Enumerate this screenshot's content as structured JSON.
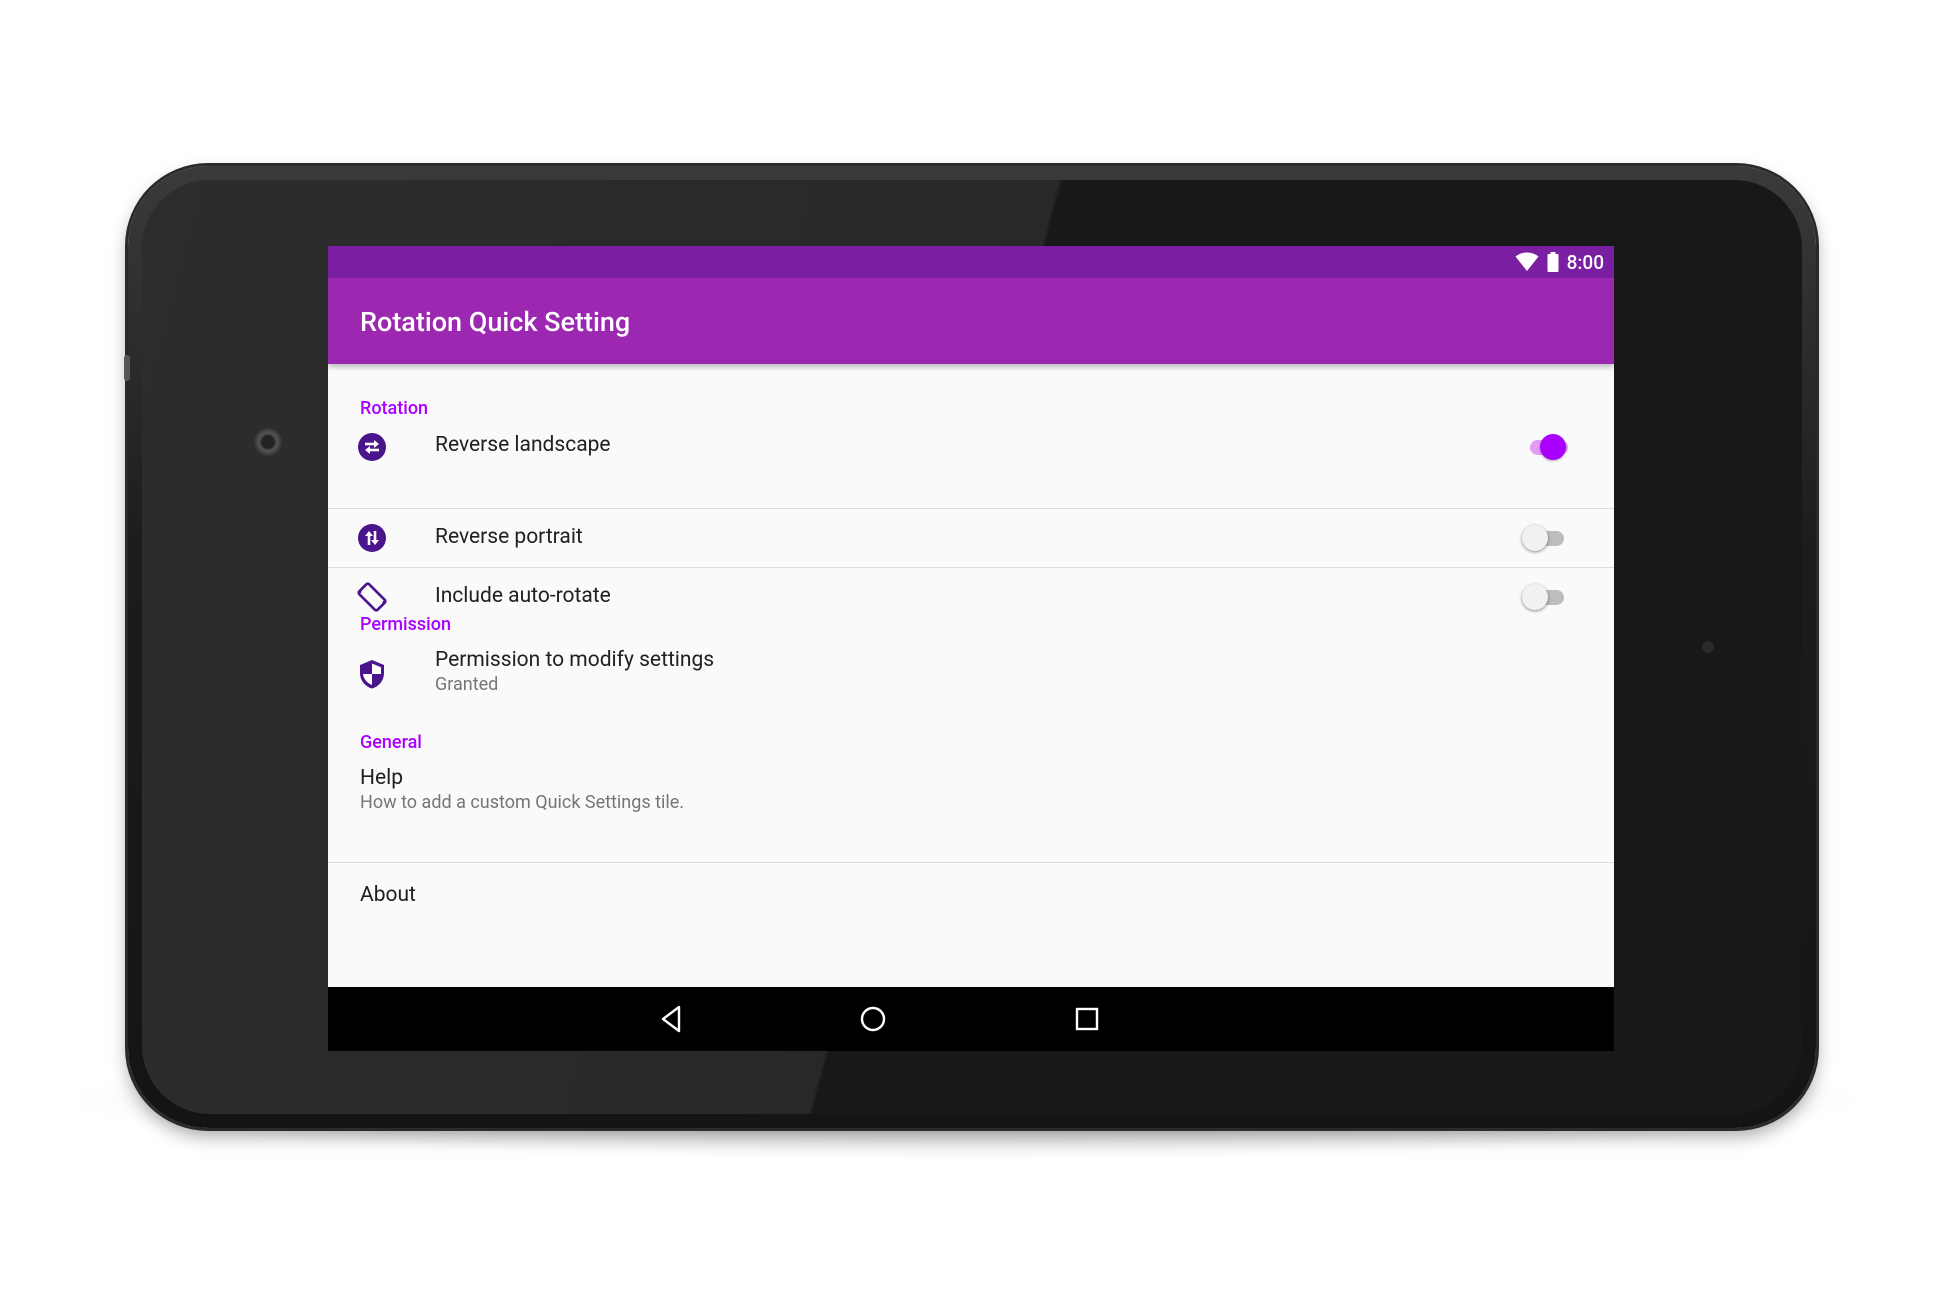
{
  "status_bar": {
    "time": "8:00",
    "icons": [
      "wifi-icon",
      "battery-icon"
    ]
  },
  "app_bar": {
    "title": "Rotation Quick Setting"
  },
  "colors": {
    "status_bar": "#7b1fa2",
    "app_bar": "#9c27b0",
    "accent": "#aa00ff",
    "icon": "#4a148c"
  },
  "sections": {
    "rotation": {
      "header": "Rotation",
      "items": [
        {
          "title": "Reverse landscape",
          "icon": "reverse-landscape-icon",
          "checked": true
        },
        {
          "title": "Reverse portrait",
          "icon": "reverse-portrait-icon",
          "checked": false
        },
        {
          "title": "Include auto-rotate",
          "icon": "screen-rotation-icon",
          "checked": false
        }
      ]
    },
    "permission": {
      "header": "Permission",
      "items": [
        {
          "title": "Permission to modify settings",
          "summary": "Granted",
          "icon": "shield-icon"
        }
      ]
    },
    "general": {
      "header": "General",
      "items": [
        {
          "title": "Help",
          "summary": "How to add a custom Quick Settings tile."
        },
        {
          "title": "About"
        }
      ]
    }
  },
  "nav_bar": {
    "buttons": [
      "back-icon",
      "home-icon",
      "recents-icon"
    ]
  }
}
